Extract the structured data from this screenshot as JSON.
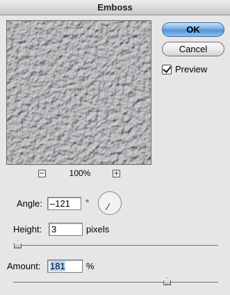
{
  "window": {
    "title": "Emboss"
  },
  "preview": {
    "zoom_minus": "−",
    "zoom_level": "100%",
    "zoom_plus": "+"
  },
  "buttons": {
    "ok": "OK",
    "cancel": "Cancel"
  },
  "preview_toggle": {
    "label": "Preview",
    "checked": true
  },
  "angle": {
    "label": "Angle:",
    "value": "–121",
    "unit": "°"
  },
  "height": {
    "label": "Height:",
    "value": "3",
    "unit": "pixels",
    "slider_fraction": 0.01
  },
  "amount": {
    "label": "Amount:",
    "value": "181",
    "unit": "%",
    "slider_fraction": 0.75
  },
  "colors": {
    "ok_button": "#4b8ed6",
    "texture": "#8d9093"
  }
}
